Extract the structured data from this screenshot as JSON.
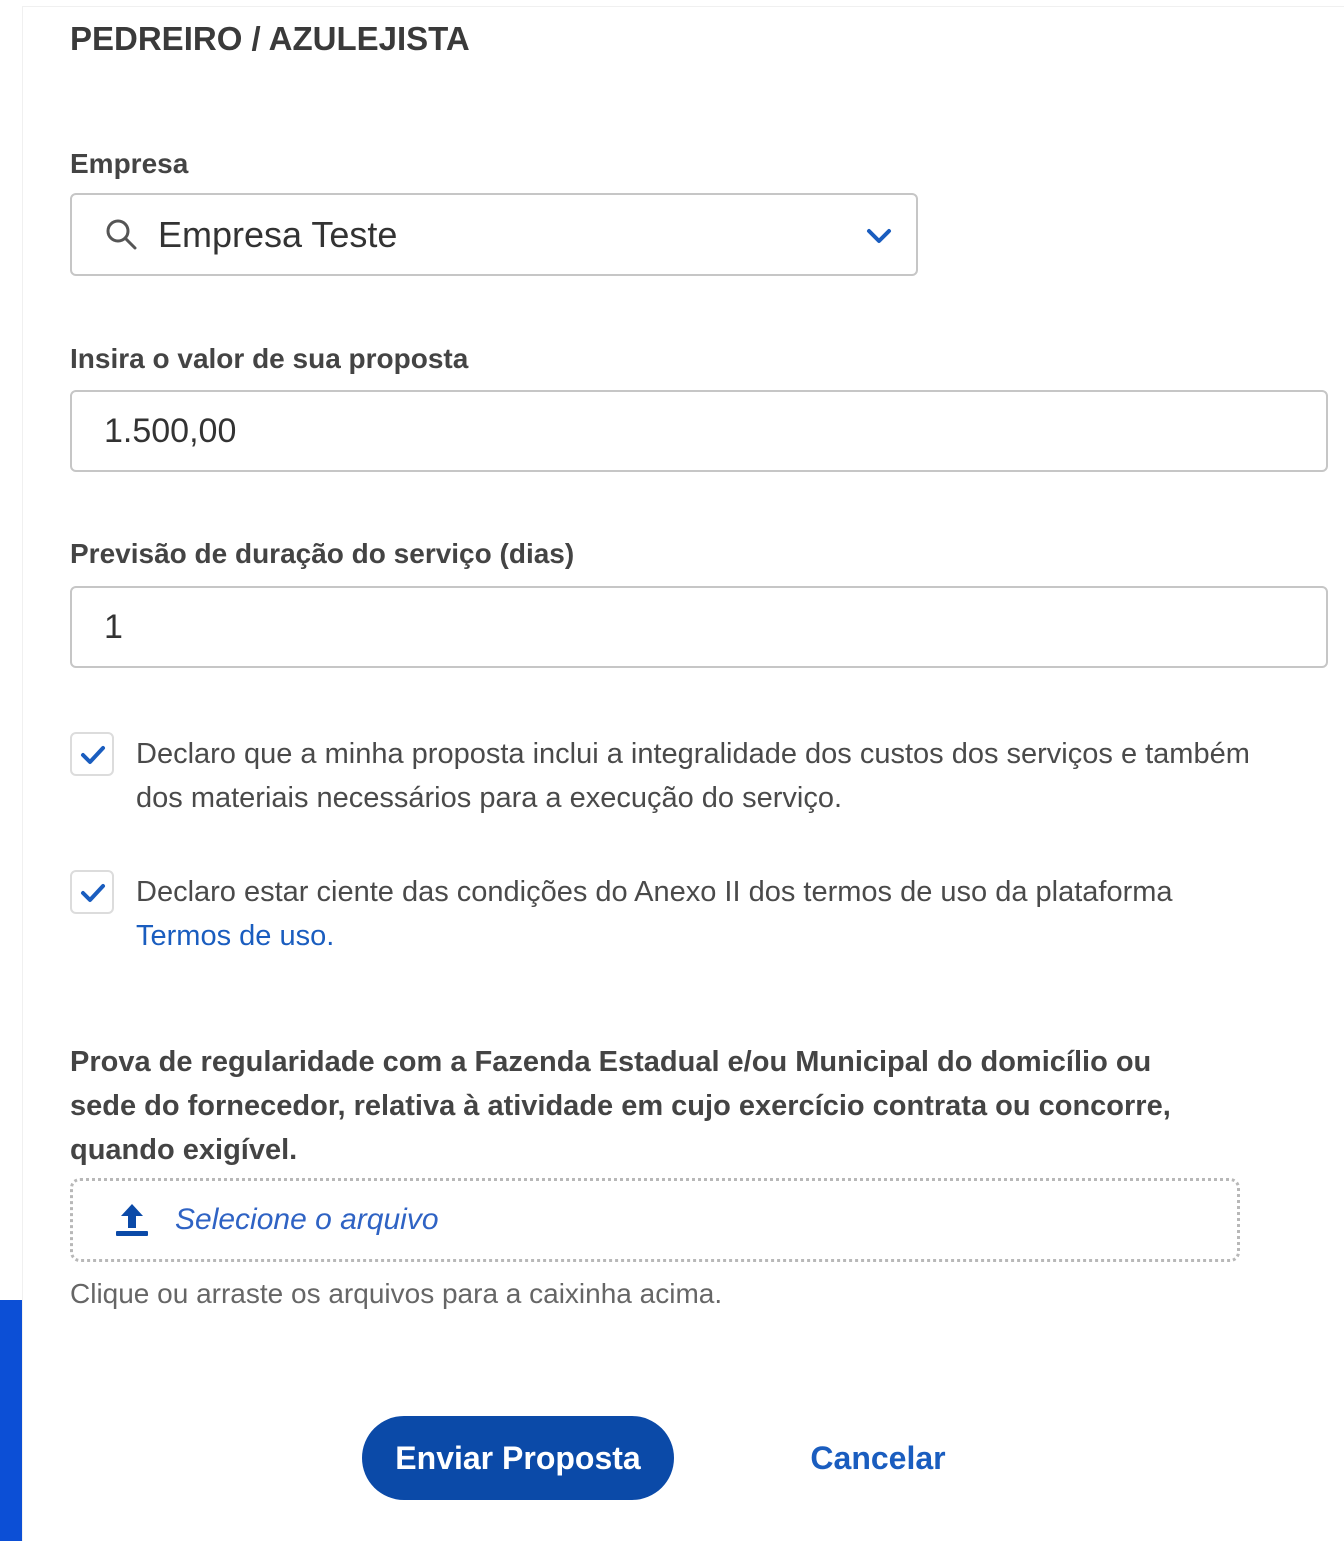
{
  "header": {
    "title": "PEDREIRO / AZULEJISTA"
  },
  "empresa": {
    "label": "Empresa",
    "selected_value": "Empresa Teste",
    "icon": "search-icon",
    "dropdown_icon": "chevron-down-icon"
  },
  "valor": {
    "label": "Insira o valor de sua proposta",
    "value": "1.500,00"
  },
  "duracao": {
    "label": "Previsão de duração do serviço (dias)",
    "value": "1"
  },
  "declaracoes": [
    {
      "checked": true,
      "text": "Declaro que a minha proposta inclui a integralidade dos custos dos serviços e também dos materiais necessários para a execução do serviço."
    },
    {
      "checked": true,
      "text": "Declaro estar ciente das condições do Anexo II dos termos de uso da plataforma",
      "link_text": "Termos de uso."
    }
  ],
  "upload": {
    "label": "Prova de regularidade com a Fazenda Estadual e/ou Municipal do domicílio ou sede do fornecedor, relativa à atividade em cujo exercício contrata ou concorre, quando exigível.",
    "placeholder": "Selecione o arquivo",
    "icon": "upload-icon",
    "hint": "Clique ou arraste os arquivos para a caixinha acima."
  },
  "actions": {
    "submit_label": "Enviar Proposta",
    "cancel_label": "Cancelar"
  },
  "colors": {
    "primary": "#0b4aa8",
    "link": "#1a5dbf",
    "accent_blue": "#0c4fd6"
  }
}
